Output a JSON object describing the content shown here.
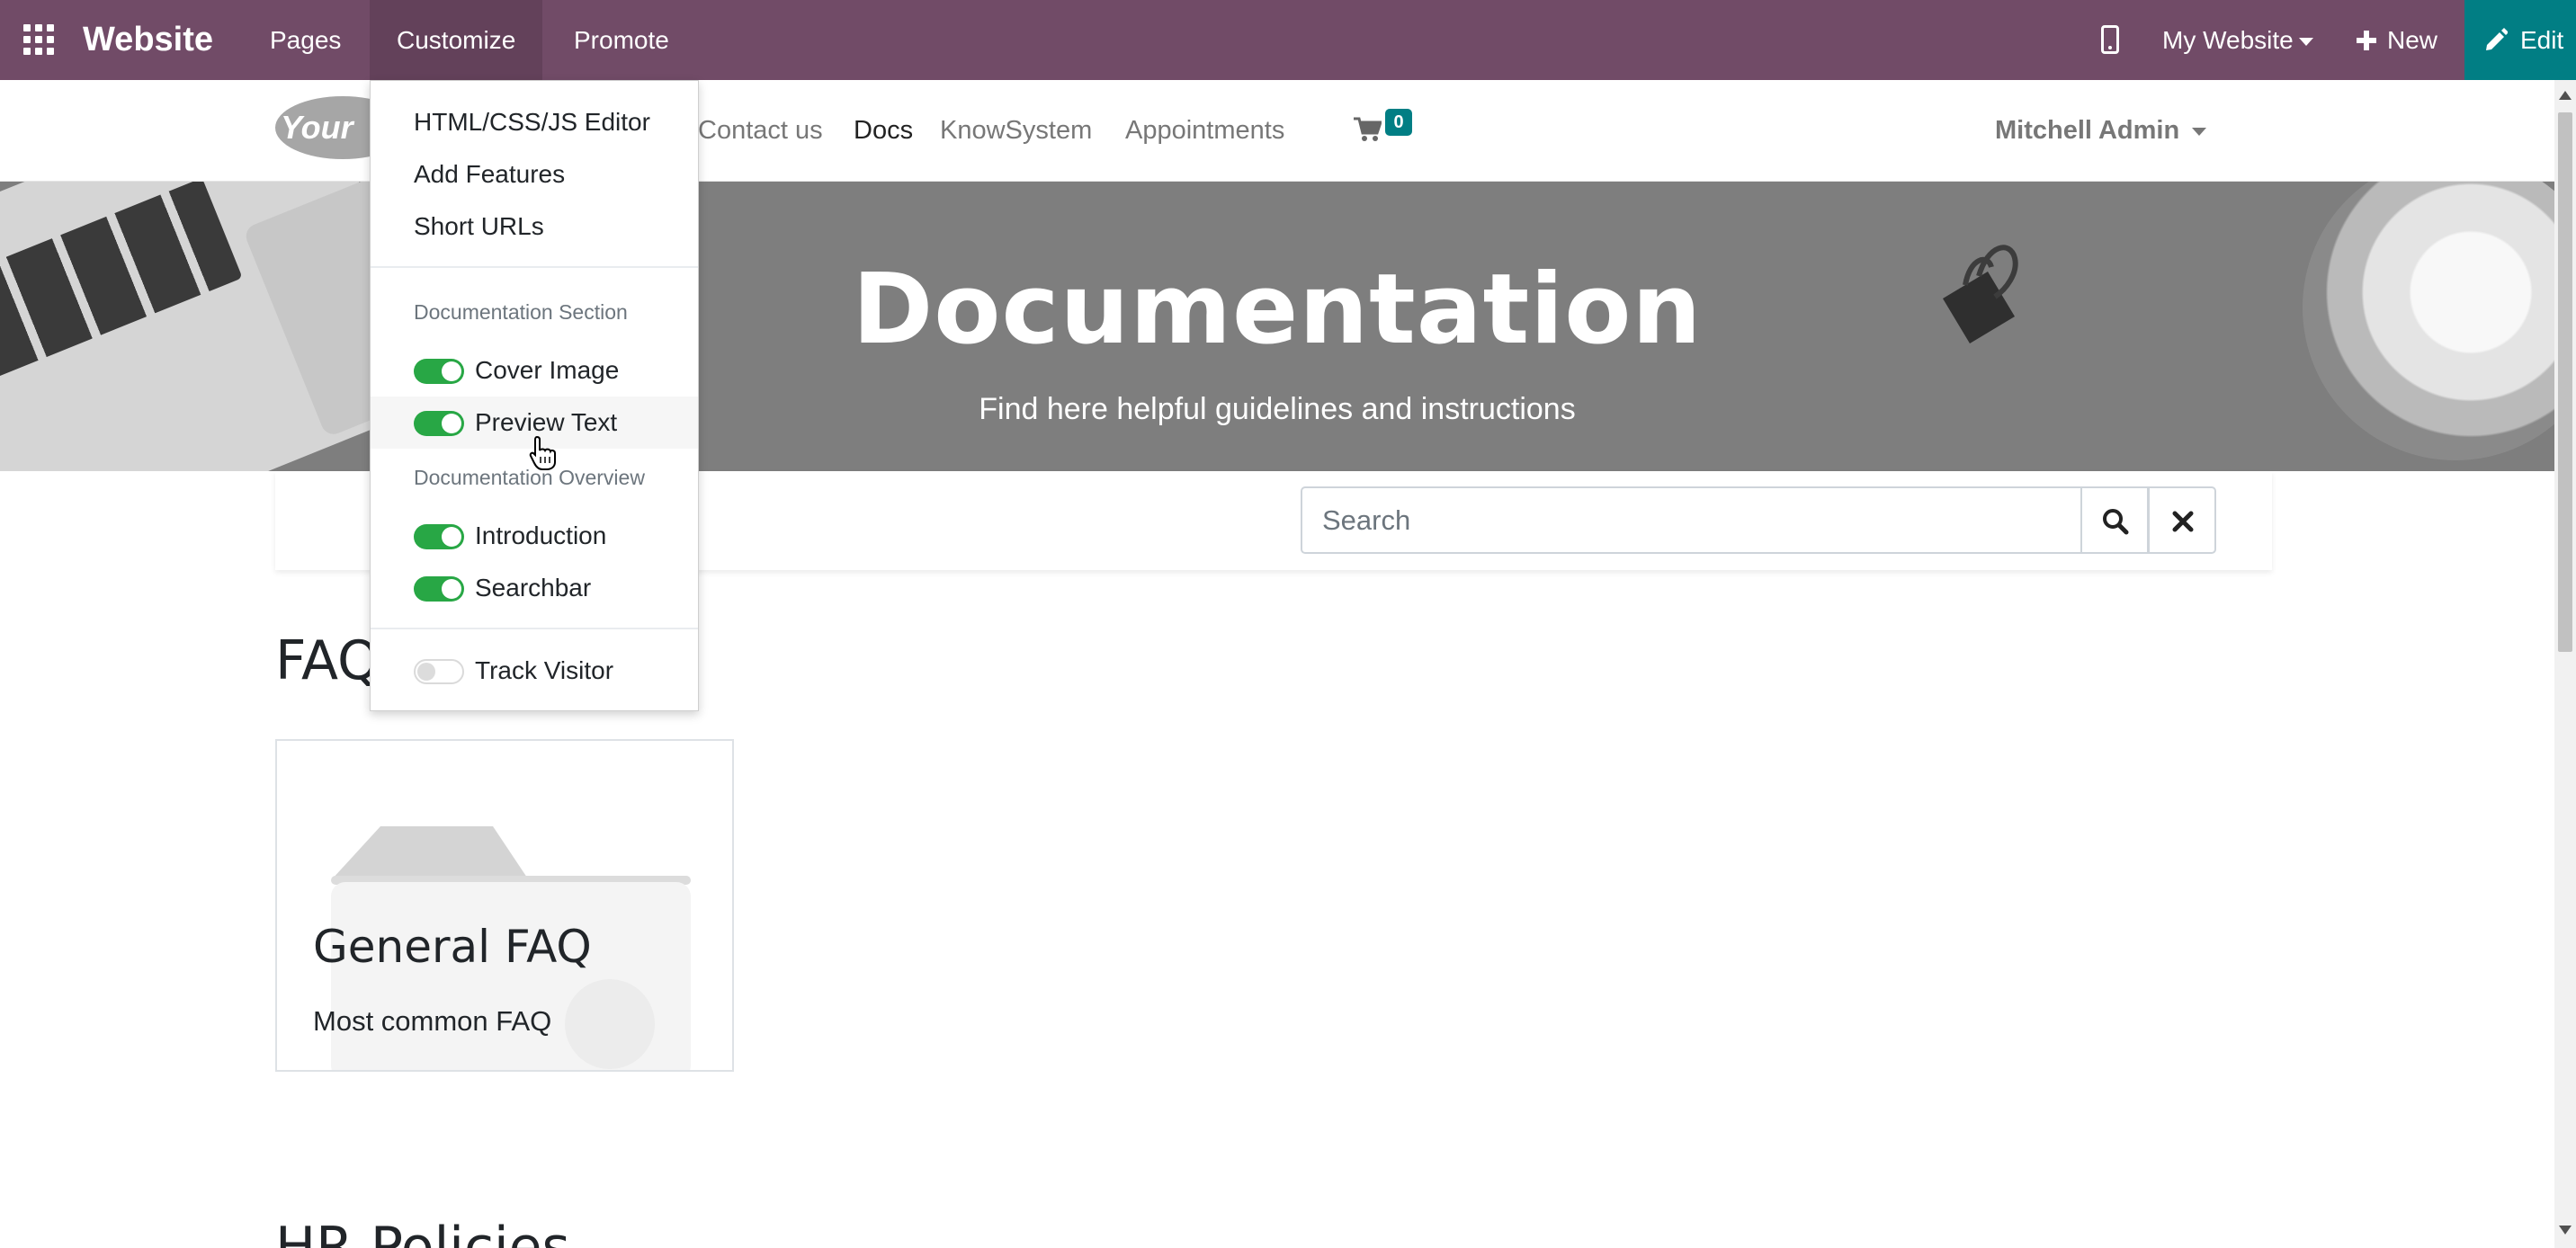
{
  "topbar": {
    "brand": "Website",
    "menus": [
      "Pages",
      "Customize",
      "Promote"
    ],
    "website_selector": "My Website",
    "new_label": "New",
    "edit_label": "Edit",
    "color": "#714b67",
    "edit_color": "#017e84"
  },
  "header": {
    "logo_text": "Your",
    "nav": [
      "Contact us",
      "Docs",
      "KnowSystem",
      "Appointments"
    ],
    "active_nav": "Docs",
    "cart_count": "0",
    "user": "Mitchell Admin"
  },
  "hero": {
    "title": "Documentation",
    "subtitle": "Find here helpful guidelines and instructions"
  },
  "search": {
    "placeholder": "Search"
  },
  "content": {
    "section1": "FAQ",
    "card_title": "General FAQ",
    "card_text": "Most common FAQ",
    "section2": "HR Policies"
  },
  "dropdown": {
    "items": [
      "HTML/CSS/JS Editor",
      "Add Features",
      "Short URLs"
    ],
    "group1_header": "Documentation Section",
    "group1": [
      {
        "label": "Cover Image",
        "on": true
      },
      {
        "label": "Preview Text",
        "on": true
      }
    ],
    "group2_header": "Documentation Overview",
    "group2": [
      {
        "label": "Introduction",
        "on": true
      },
      {
        "label": "Searchbar",
        "on": true
      }
    ],
    "track_visitor": {
      "label": "Track Visitor",
      "on": false
    },
    "toggle_on_color": "#28a745"
  }
}
